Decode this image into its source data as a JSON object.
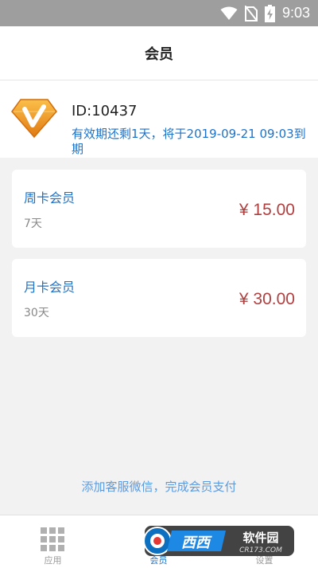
{
  "status_bar": {
    "time": "9:03",
    "icons": [
      "wifi-icon",
      "no-sim-icon",
      "battery-charging-icon"
    ]
  },
  "header": {
    "title": "会员"
  },
  "member": {
    "id_text": "ID:10437",
    "expiry_text": "有效期还剩1天，将于2019-09-21 09:03到期",
    "badge_icon": "vip-diamond-icon"
  },
  "plans": [
    {
      "name": "周卡会员",
      "duration": "7天",
      "price": "¥ 15.00"
    },
    {
      "name": "月卡会员",
      "duration": "30天",
      "price": "¥ 30.00"
    }
  ],
  "contact_hint": "添加客服微信，完成会员支付",
  "bottom_nav": {
    "items": [
      {
        "label": "应用",
        "icon": "grid-icon",
        "active": false
      },
      {
        "label": "会员",
        "icon": "member-icon",
        "active": true
      },
      {
        "label": "设置",
        "icon": "settings-icon",
        "active": false
      }
    ]
  },
  "watermark": {
    "text_cn": "西西软件园",
    "text_en": "CR173.COM"
  },
  "colors": {
    "accent": "#1d73c9",
    "price": "#b04040",
    "status_bar": "#9e9e9e",
    "background": "#f2f2f2",
    "badge_orange": "#f5a623"
  }
}
